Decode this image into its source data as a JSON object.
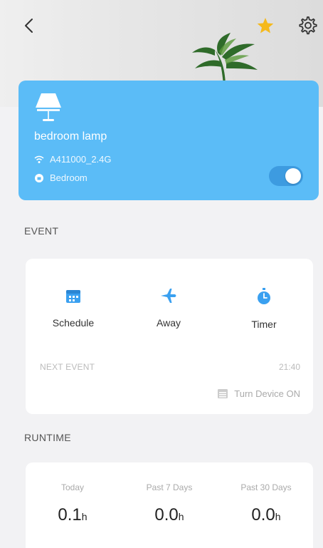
{
  "device": {
    "name": "bedroom lamp",
    "network": "A411000_2.4G",
    "room": "Bedroom",
    "power_on": true
  },
  "colors": {
    "card_accent": "#5bbcf7",
    "icon_blue": "#3aa0f0",
    "favorite_star": "#f5b91c"
  },
  "icons": {
    "back": "chevron-left-icon",
    "favorite": "star-icon",
    "settings": "gear-icon"
  },
  "event": {
    "section_title": "EVENT",
    "options": [
      {
        "label": "Schedule",
        "icon": "calendar-icon"
      },
      {
        "label": "Away",
        "icon": "airplane-icon"
      },
      {
        "label": "Timer",
        "icon": "stopwatch-icon"
      }
    ],
    "next_event_label": "NEXT EVENT",
    "next_event_time": "21:40",
    "next_event_action": "Turn Device ON"
  },
  "runtime": {
    "section_title": "RUNTIME",
    "periods": [
      {
        "label": "Today",
        "value": "0.1",
        "unit": "h"
      },
      {
        "label": "Past 7 Days",
        "value": "0.0",
        "unit": "h"
      },
      {
        "label": "Past 30 Days",
        "value": "0.0",
        "unit": "h"
      }
    ]
  }
}
